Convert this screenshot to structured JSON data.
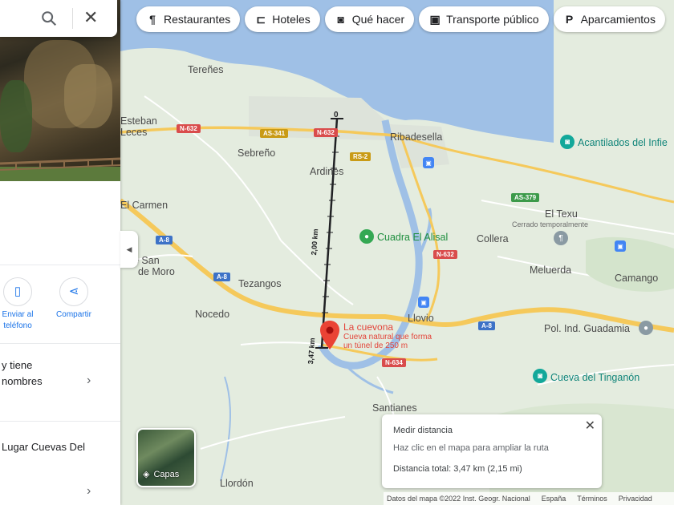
{
  "chips": [
    {
      "icon": "restaurant-icon",
      "glyph": "¶",
      "label": "Restaurantes"
    },
    {
      "icon": "hotel-icon",
      "glyph": "⊏",
      "label": "Hoteles"
    },
    {
      "icon": "camera-icon",
      "glyph": "◙",
      "label": "Qué hacer"
    },
    {
      "icon": "transit-icon",
      "glyph": "▣",
      "label": "Transporte público"
    },
    {
      "icon": "parking-icon",
      "glyph": "P",
      "label": "Aparcamientos"
    }
  ],
  "places": {
    "terenes": "Tereñes",
    "esteban": "Esteban",
    "leces": "Leces",
    "sebreno": "Sebreño",
    "ardines": "Ardines",
    "ribadesella": "Ribadesella",
    "el_carmen": "El Carmen",
    "san_de": "e San",
    "de_moro": "de Moro",
    "tezangos": "Tezangos",
    "nocedo": "Nocedo",
    "collera": "Collera",
    "el_texu": "El Texu",
    "cerrado": "Cerrado temporalmente",
    "meluerda": "Meluerda",
    "camango": "Camango",
    "llovio": "Llovio",
    "santianes": "Santianes",
    "llordon": "Llordón",
    "pol_ind": "Pol. Ind. Guadamia"
  },
  "pois": {
    "acantilados": "Acantilados del Infie",
    "cuadra": "Cuadra El Alisal",
    "tinganon": "Cueva del Tinganón",
    "cuevona": "La cuevona",
    "cuevona_desc1": "Cueva natural que forma",
    "cuevona_desc2": "un túnel de 250 m"
  },
  "roads": {
    "n632a": "N-632",
    "as341": "AS-341",
    "n632b": "N-632",
    "rs2": "RS-2",
    "as379": "AS-379",
    "n632c": "N-632",
    "a8a": "A-8",
    "a8b": "A-8",
    "a8c": "A-8",
    "n634": "N-634"
  },
  "measure_line": {
    "start_label": "0",
    "mid_label": "2,00 km",
    "end_label": "3,47 km"
  },
  "measure_card": {
    "title": "Medir distancia",
    "hint": "Haz clic en el mapa para ampliar la ruta",
    "total": "Distancia total: 3,47 km (2,15 mi)"
  },
  "layers_label": "Capas",
  "footer": {
    "data": "Datos del mapa ©2022 Inst. Geogr. Nacional",
    "country": "España",
    "terms": "Términos",
    "privacy": "Privacidad"
  },
  "panel": {
    "send_label1": "Enviar al",
    "send_label2": "teléfono",
    "share_label": "Compartir",
    "text1": "y tiene",
    "text2": "nombres",
    "text3": "Lugar Cuevas Del"
  },
  "colors": {
    "water": "#9fc0e6",
    "highway": "#f5c95b",
    "accent": "#1a73e8"
  }
}
